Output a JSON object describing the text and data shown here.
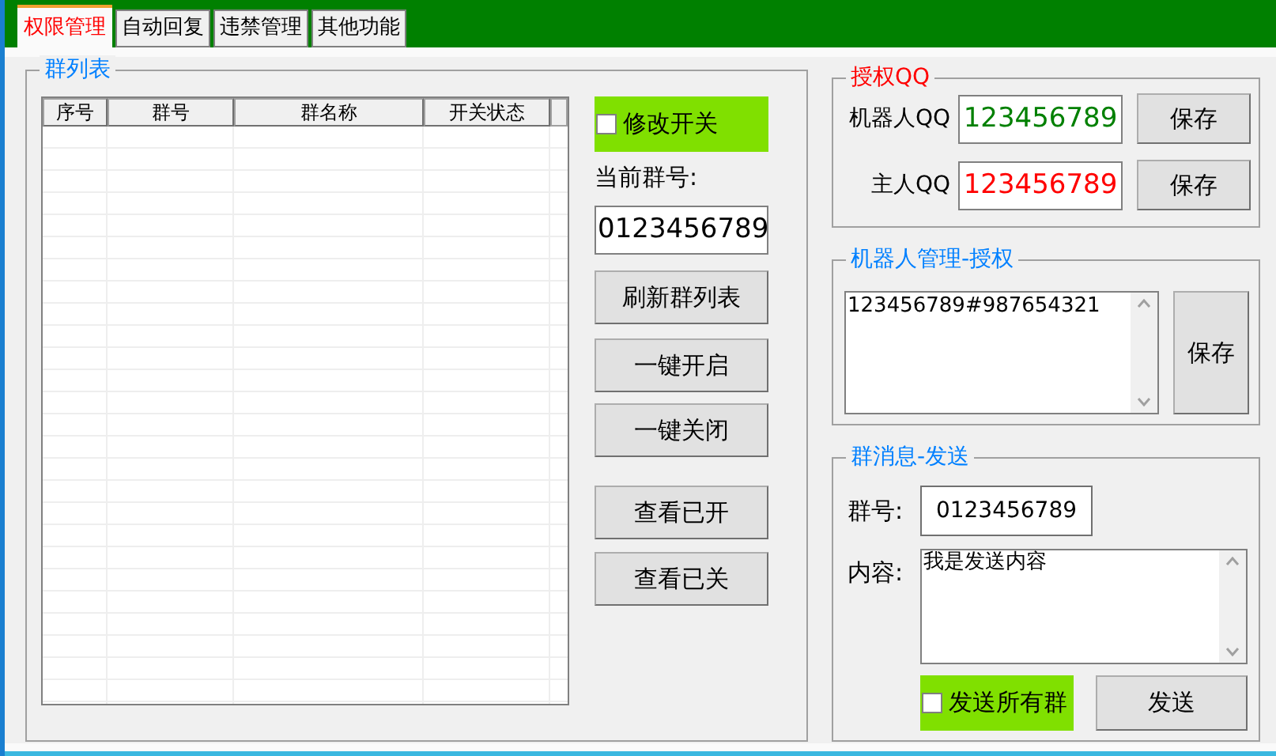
{
  "tabs": [
    {
      "label": "权限管理",
      "selected": true
    },
    {
      "label": "自动回复",
      "selected": false
    },
    {
      "label": "违禁管理",
      "selected": false
    },
    {
      "label": "其他功能",
      "selected": false
    }
  ],
  "group_list": {
    "title": "群列表",
    "table": {
      "columns": [
        "序号",
        "群号",
        "群名称",
        "开关状态"
      ]
    },
    "edit_switch": {
      "label": "修改开关",
      "checked": false
    },
    "current_group_label": "当前群号:",
    "current_group": "0123456789",
    "buttons": [
      "刷新群列表",
      "一键开启",
      "一键关闭",
      "查看已开",
      "查看已关"
    ]
  },
  "auth_qq": {
    "title": "授权QQ",
    "rows": [
      {
        "label": "机器人QQ",
        "value": "123456789",
        "color": "#008000",
        "button": "保存"
      },
      {
        "label": "主人QQ",
        "value": "123456789",
        "color": "#ff0000",
        "button": "保存"
      }
    ]
  },
  "robot_auth": {
    "title": "机器人管理-授权",
    "content": "123456789#987654321",
    "button": "保存"
  },
  "group_message": {
    "title": "群消息-发送",
    "group_label": "群号:",
    "group_value": "0123456789",
    "content_label": "内容:",
    "content": "我是发送内容",
    "send_all": {
      "label": "发送所有群",
      "checked": false
    },
    "send_button": "发送"
  }
}
